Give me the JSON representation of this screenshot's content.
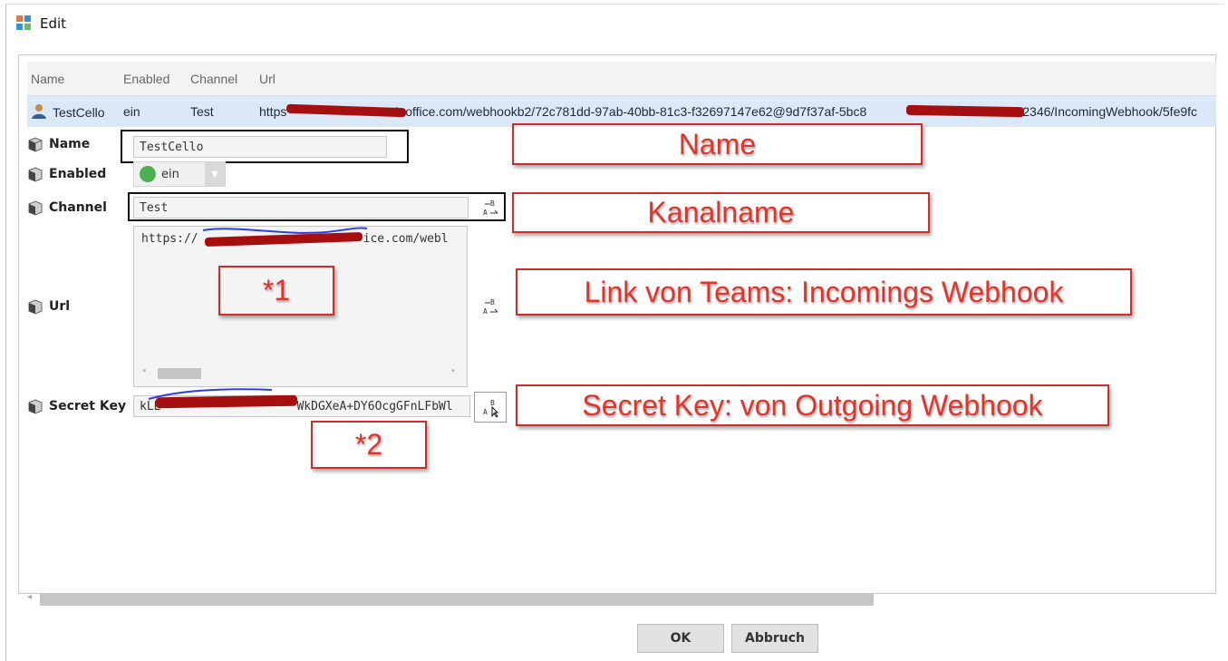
{
  "window": {
    "title": "Edit"
  },
  "table": {
    "headers": {
      "name": "Name",
      "enabled": "Enabled",
      "channel": "Channel",
      "url": "Url"
    },
    "row": {
      "name": "TestCello",
      "enabled": "ein",
      "channel": "Test",
      "url_prefix": "https",
      "url_middle": "k.office.com/webhookb2/72c781dd-97ab-40bb-81c3-f32697147e62@9d7f37af-5bc8",
      "url_suffix": "2346/IncomingWebhook/5fe9fc"
    }
  },
  "form": {
    "name": {
      "label": "Name",
      "value": "TestCello"
    },
    "enabled": {
      "label": "Enabled",
      "value": "ein"
    },
    "channel": {
      "label": "Channel",
      "value": "Test"
    },
    "url": {
      "label": "Url",
      "value_prefix": "https://",
      "value_suffix": "ice.com/webl"
    },
    "secret": {
      "label": "Secret Key",
      "value_prefix": "kLE",
      "value_suffix": "WkDGXeA+DY6OcgGFnLFbWl"
    }
  },
  "annotations": {
    "name": "Name",
    "channel": "Kanalname",
    "url": "Link von Teams: Incomings Webhook",
    "note1": "*1",
    "secret": "Secret Key: von Outgoing Webhook",
    "note2": "*2"
  },
  "buttons": {
    "ok": "OK",
    "cancel": "Abbruch"
  },
  "icons": {
    "app": "app-grid-icon",
    "user": "user-icon",
    "field": "cube-icon",
    "text_edit": "text-ab-icon",
    "status": "green-dot-icon"
  },
  "colors": {
    "selected_row": "#dbe8f7",
    "annotation_red": "#e3342a",
    "status_green": "#4caf50"
  }
}
